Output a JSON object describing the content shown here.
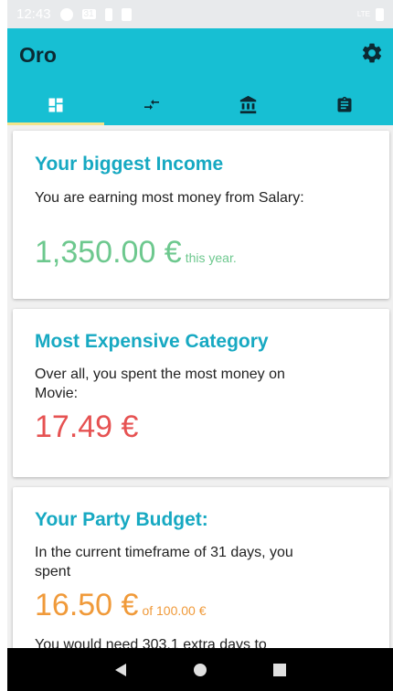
{
  "statusbar": {
    "time": "12:43",
    "calendar_day": "31",
    "signal": "LTE"
  },
  "app": {
    "title": "Oro"
  },
  "tabs": [
    {
      "icon": "dashboard-icon",
      "active": true
    },
    {
      "icon": "transfer-arrows-icon",
      "active": false
    },
    {
      "icon": "bank-icon",
      "active": false
    },
    {
      "icon": "clipboard-icon",
      "active": false
    }
  ],
  "cards": {
    "income": {
      "title": "Your biggest Income",
      "text": "You are earning most money from Salary:",
      "amount": "1,350.00 €",
      "suffix": "this year.",
      "color": "#6dc88e"
    },
    "expense": {
      "title": "Most Expensive Category",
      "text": "Over all, you spent the most money on Movie:",
      "amount": "17.49 €",
      "color": "#e65252"
    },
    "party": {
      "title": "Your Party Budget:",
      "text": "In the current timeframe of 31 days, you spent",
      "amount": "16.50 €",
      "suffix": "of 100.00 €",
      "footer": "You would need 303.1 extra days to",
      "color": "#f09a3a"
    }
  },
  "colors": {
    "primary": "#17bfd3",
    "title_text": "#17a9c2",
    "indicator": "#f2e48a"
  }
}
